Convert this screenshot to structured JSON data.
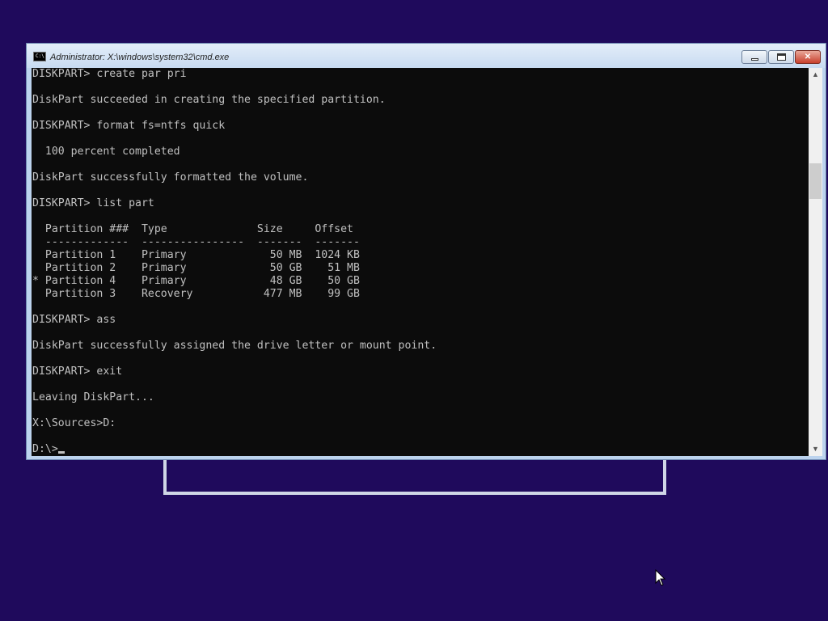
{
  "window": {
    "title": "Administrator: X:\\windows\\system32\\cmd.exe",
    "icon_label": "C:\\",
    "minimize_icon": "minimize-icon",
    "maximize_icon": "restore-icon",
    "close_label": "✕"
  },
  "console": {
    "lines": [
      "DISKPART> create par pri",
      "",
      "DiskPart succeeded in creating the specified partition.",
      "",
      "DISKPART> format fs=ntfs quick",
      "",
      "  100 percent completed",
      "",
      "DiskPart successfully formatted the volume.",
      "",
      "DISKPART> list part",
      "",
      "  Partition ###  Type              Size     Offset",
      "  -------------  ----------------  -------  -------",
      "  Partition 1    Primary             50 MB  1024 KB",
      "  Partition 2    Primary             50 GB    51 MB",
      "* Partition 4    Primary             48 GB    50 GB",
      "  Partition 3    Recovery           477 MB    99 GB",
      "",
      "DISKPART> ass",
      "",
      "DiskPart successfully assigned the drive letter or mount point.",
      "",
      "DISKPART> exit",
      "",
      "Leaving DiskPart...",
      "",
      "X:\\Sources>D:",
      "",
      "D:\\>"
    ]
  },
  "scrollbar": {
    "up_arrow": "▲",
    "down_arrow": "▼",
    "position": 0.25
  },
  "colors": {
    "desktop": "#1f0a5c",
    "console_bg": "#0c0c0c",
    "console_fg": "#c0c0c0"
  }
}
